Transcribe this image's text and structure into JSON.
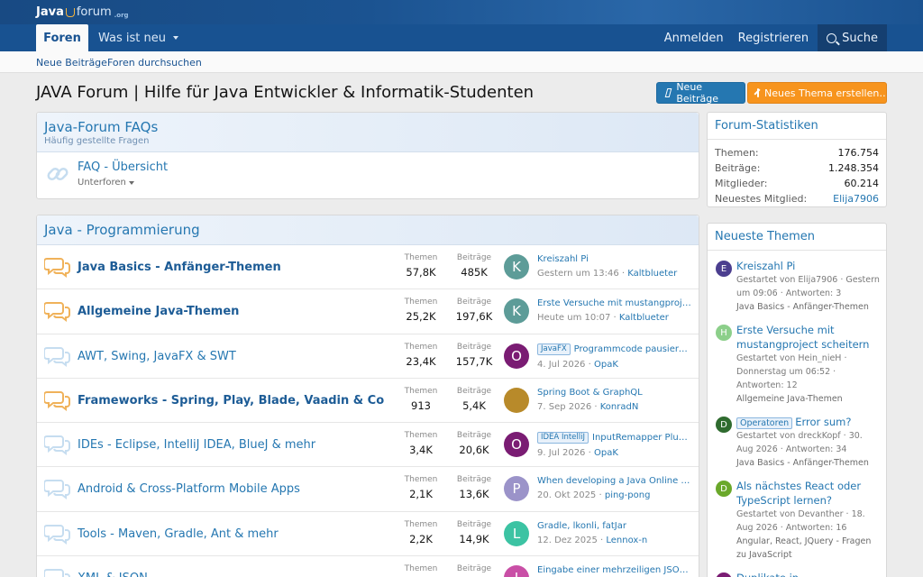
{
  "header": {
    "logo_text": "Java",
    "logo_forum": "forum",
    "logo_org": ".org"
  },
  "nav": {
    "active_tab": "Foren",
    "tab2": "Was ist neu",
    "login": "Anmelden",
    "register": "Registrieren",
    "search": "Suche"
  },
  "subnav": {
    "link1": "Neue Beiträge",
    "link2": "Foren durchsuchen"
  },
  "page": {
    "title": "JAVA Forum | Hilfe für Java Entwickler & Informatik-Studenten",
    "btn_new_posts": "Neue Beiträge",
    "btn_new_thread": "Neues Thema erstellen…"
  },
  "faq": {
    "title": "Java-Forum FAQs",
    "desc": "Häufig gestellte Fragen",
    "row_name": "FAQ - Übersicht",
    "row_sub": "Unterforen"
  },
  "java": {
    "title": "Java - Programmierung",
    "label_threads": "Themen",
    "label_posts": "Beiträge",
    "nodes": [
      {
        "name": "Java Basics - Anfänger-Themen",
        "bold": true,
        "threads": "57,8K",
        "posts": "485K",
        "avatar": "K",
        "avatar_color": "#5d9c98",
        "last_title": "Kreiszahl Pi",
        "prefix": "",
        "last_date": "Gestern um 13:46",
        "last_user": "Kaltblueter"
      },
      {
        "name": "Allgemeine Java-Themen",
        "bold": true,
        "threads": "25,2K",
        "posts": "197,6K",
        "avatar": "K",
        "avatar_color": "#5d9c98",
        "last_title": "Erste Versuche mit mustangproject scheitern",
        "prefix": "",
        "last_date": "Heute um 10:07",
        "last_user": "Kaltblueter"
      },
      {
        "name": "AWT, Swing, JavaFX & SWT",
        "bold": false,
        "threads": "23,4K",
        "posts": "157,7K",
        "avatar": "O",
        "avatar_color": "#7a1c73",
        "last_title": "Programmcode pausieren lassen",
        "prefix": "JavaFX",
        "last_date": "4. Jul 2026",
        "last_user": "OpaK"
      },
      {
        "name": "Frameworks - Spring, Play, Blade, Vaadin & Co",
        "bold": true,
        "threads": "913",
        "posts": "5,4K",
        "avatar": "",
        "avatar_color": "#b88a2a",
        "last_title": "Spring Boot & GraphQL",
        "prefix": "",
        "last_date": "7. Sep 2026",
        "last_user": "KonradN"
      },
      {
        "name": "IDEs - Eclipse, IntelliJ IDEA, BlueJ & mehr",
        "bold": false,
        "threads": "3,4K",
        "posts": "20,6K",
        "avatar": "O",
        "avatar_color": "#7a1c73",
        "last_title": "InputRemapper Plugin",
        "prefix": "IDEA IntelliJ",
        "last_date": "9. Jul 2026",
        "last_user": "OpaK"
      },
      {
        "name": "Android & Cross-Platform Mobile Apps",
        "bold": false,
        "threads": "2,1K",
        "posts": "13,6K",
        "avatar": "P",
        "avatar_color": "#9b93c9",
        "last_title": "When developing a Java Online Mobile App",
        "prefix": "",
        "last_date": "20. Okt 2025",
        "last_user": "ping-pong"
      },
      {
        "name": "Tools - Maven, Gradle, Ant & mehr",
        "bold": false,
        "threads": "2,2K",
        "posts": "14,9K",
        "avatar": "L",
        "avatar_color": "#3cc3a3",
        "last_title": "Gradle, lkonli, fatJar",
        "prefix": "",
        "last_date": "12. Dez 2025",
        "last_user": "Lennox-n"
      },
      {
        "name": "XML & JSON",
        "bold": false,
        "threads": "",
        "posts": "",
        "avatar": "I",
        "avatar_color": "#c94fa6",
        "last_title": "Eingabe einer mehrzeiligen JSON-Datei",
        "prefix": "",
        "last_date": "",
        "last_user": ""
      }
    ]
  },
  "stats": {
    "title": "Forum-Statistiken",
    "rows": [
      {
        "k": "Themen:",
        "v": "176.754"
      },
      {
        "k": "Beiträge:",
        "v": "1.248.354"
      },
      {
        "k": "Mitglieder:",
        "v": "60.214"
      },
      {
        "k": "Neuestes Mitglied:",
        "v": "Elija7906"
      }
    ]
  },
  "latest": {
    "title": "Neueste Themen",
    "threads": [
      {
        "avatar": "E",
        "color": "#4b3e8f",
        "title": "Kreiszahl Pi",
        "prefix": "",
        "meta": "Gestartet von Elija7906 · Gestern um 09:06 · Antworten: 3",
        "forum": "Java Basics - Anfänger-Themen"
      },
      {
        "avatar": "H",
        "color": "#8ccf8a",
        "title": "Erste Versuche mit mustangproject scheitern",
        "prefix": "",
        "meta": "Gestartet von Hein_nieH · Donnerstag um 06:52 · Antworten: 12",
        "forum": "Allgemeine Java-Themen"
      },
      {
        "avatar": "D",
        "color": "#2f6b2f",
        "title": "Error sum?",
        "prefix": "Operatoren",
        "meta": "Gestartet von dreckKopf · 30. Aug 2026 · Antworten: 34",
        "forum": "Java Basics - Anfänger-Themen"
      },
      {
        "avatar": "D",
        "color": "#6aa82a",
        "title": "Als nächstes React oder TypeScript lernen?",
        "prefix": "",
        "meta": "Gestartet von Devanther · 18. Aug 2026 · Antworten: 16",
        "forum": "Angular, React, JQuery - Fragen zu JavaScript"
      },
      {
        "avatar": "O",
        "color": "#7a1c73",
        "title": "Duplikate in Funktionsbildmenge",
        "prefix": "",
        "meta": "",
        "forum": ""
      }
    ]
  }
}
